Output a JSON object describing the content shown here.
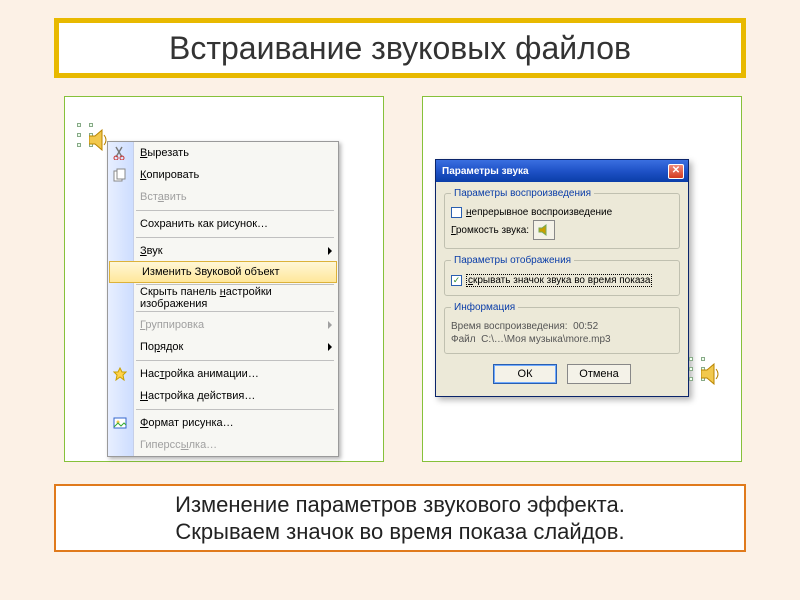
{
  "title": "Встраивание звуковых файлов",
  "caption": {
    "line1": "Изменение параметров звукового эффекта.",
    "line2": "Скрываем значок во время показа слайдов."
  },
  "contextMenu": {
    "cut": "Вырезать",
    "copy": "Копировать",
    "paste": "Вставить",
    "saveAsPicture": "Сохранить как рисунок…",
    "sound": "Звук",
    "editSoundObject": "Изменить Звуковой объект",
    "hideImageToolbar": "Скрыть панель настройки изображения",
    "grouping": "Группировка",
    "order": "Порядок",
    "customAnimation": "Настройка анимации…",
    "actionSettings": "Настройка действия…",
    "formatPicture": "Формат рисунка…",
    "hyperlink": "Гиперссылка…"
  },
  "dialog": {
    "title": "Параметры звука",
    "groupPlayback": "Параметры воспроизведения",
    "loop": "Непрерывное воспроизведение",
    "volumeLabel": "Громкость звука:",
    "groupDisplay": "Параметры отображения",
    "hideIcon": "скрывать значок звука во время показа",
    "groupInfo": "Информация",
    "durationLabel": "Время воспроизведения:",
    "durationValue": "00:52",
    "fileLabel": "Файл",
    "filePath": "C:\\…\\Моя музыка\\more.mp3",
    "ok": "ОК",
    "cancel": "Отмена"
  },
  "icons": {
    "speaker": "speaker-icon",
    "cut": "cut-icon",
    "copy": "copy-icon",
    "customAnimation": "animation-icon",
    "formatPicture": "picture-icon",
    "close": "close-icon",
    "volume": "volume-icon"
  },
  "colors": {
    "titleBorder": "#e8b900",
    "panelBorder": "#86c13a",
    "captionBorder": "#e07a1c",
    "xpBlue": "#1f52c7"
  }
}
